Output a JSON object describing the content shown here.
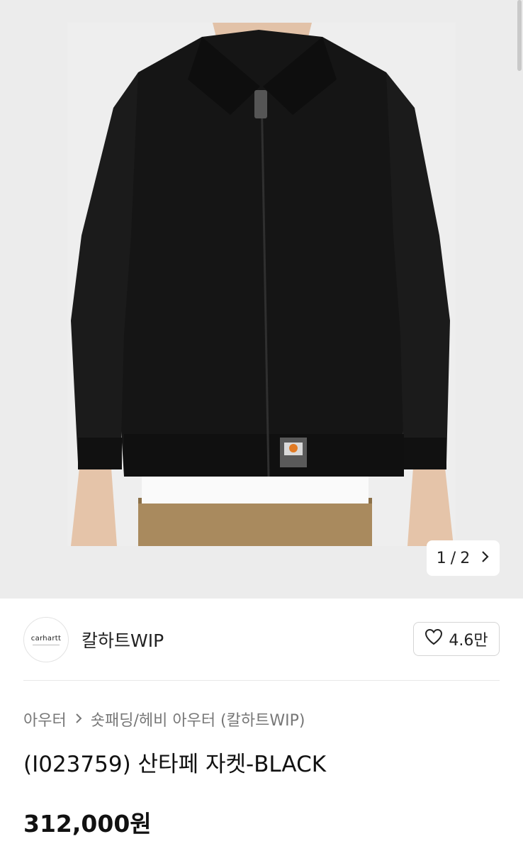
{
  "gallery": {
    "current": "1",
    "separator": "/",
    "total": "2",
    "image_alt": "black zip jacket on model"
  },
  "brand": {
    "logo_text": "carhartt",
    "name": "칼하트WIP"
  },
  "like": {
    "icon": "heart-outline-icon",
    "count": "4.6만"
  },
  "breadcrumb": {
    "category": "아우터",
    "subcategory": "숏패딩/헤비 아우터 (칼하트WIP)"
  },
  "product": {
    "title": "(I023759) 산타페 자켓-BLACK",
    "price": "312,000원"
  },
  "colors": {
    "gallery_bg": "#ececec",
    "jacket": "#151515",
    "pants": "#a98a5e",
    "text_muted": "#777777"
  }
}
